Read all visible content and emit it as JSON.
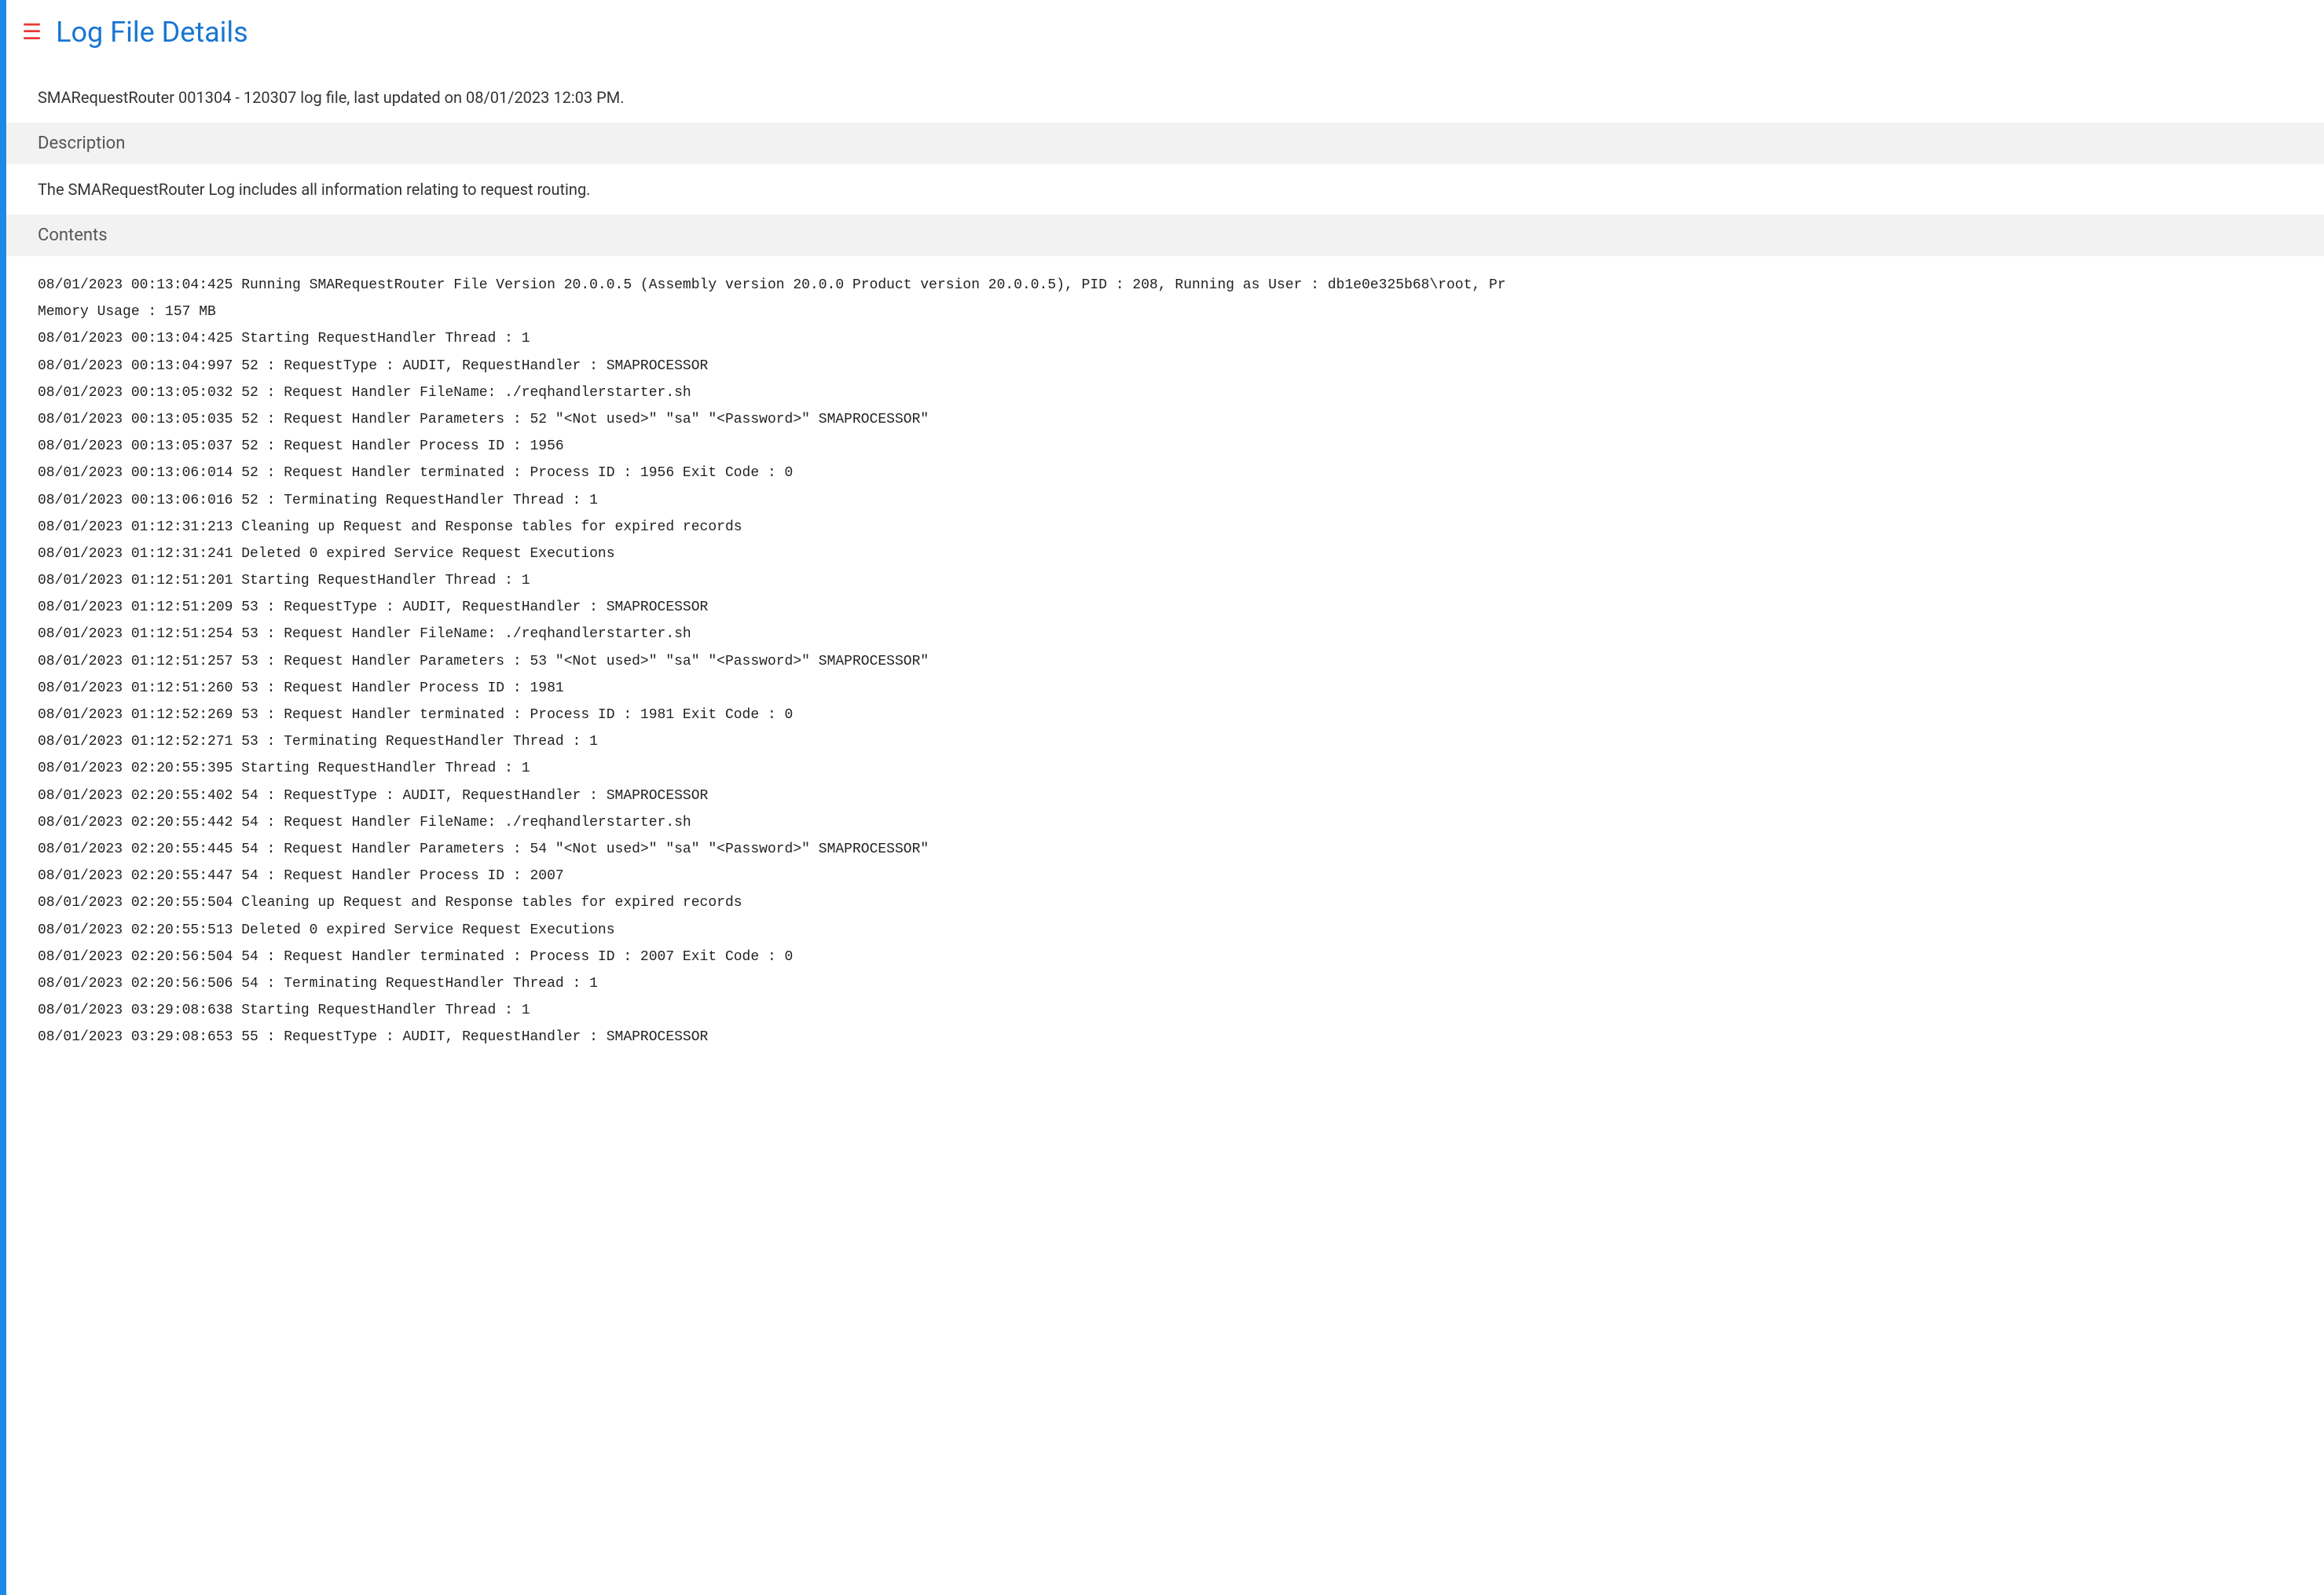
{
  "header": {
    "title": "Log File Details"
  },
  "subtitle": "SMARequestRouter 001304 - 120307 log file, last updated on 08/01/2023 12:03 PM.",
  "sections": {
    "description_label": "Description",
    "description_text": "The SMARequestRouter Log includes all information relating to request routing.",
    "contents_label": "Contents"
  },
  "log_lines": [
    "08/01/2023 00:13:04:425 Running SMARequestRouter File Version 20.0.0.5 (Assembly version 20.0.0 Product version 20.0.0.5), PID : 208, Running as User : db1e0e325b68\\root, Pr",
    "Memory Usage : 157 MB",
    "08/01/2023 00:13:04:425 Starting RequestHandler Thread : 1",
    "08/01/2023 00:13:04:997 52 : RequestType : AUDIT, RequestHandler : SMAPROCESSOR",
    "08/01/2023 00:13:05:032 52 : Request Handler FileName: ./reqhandlerstarter.sh",
    "08/01/2023 00:13:05:035 52 : Request Handler Parameters : 52 \"<Not used>\" \"sa\" \"<Password>\" SMAPROCESSOR\"",
    "08/01/2023 00:13:05:037 52 : Request Handler Process ID : 1956",
    "08/01/2023 00:13:06:014 52 : Request Handler terminated : Process ID : 1956 Exit Code : 0",
    "08/01/2023 00:13:06:016 52 : Terminating RequestHandler Thread : 1",
    "08/01/2023 01:12:31:213 Cleaning up Request and Response tables for expired records",
    "08/01/2023 01:12:31:241 Deleted 0 expired Service Request Executions",
    "08/01/2023 01:12:51:201 Starting RequestHandler Thread : 1",
    "08/01/2023 01:12:51:209 53 : RequestType : AUDIT, RequestHandler : SMAPROCESSOR",
    "08/01/2023 01:12:51:254 53 : Request Handler FileName: ./reqhandlerstarter.sh",
    "08/01/2023 01:12:51:257 53 : Request Handler Parameters : 53 \"<Not used>\" \"sa\" \"<Password>\" SMAPROCESSOR\"",
    "08/01/2023 01:12:51:260 53 : Request Handler Process ID : 1981",
    "08/01/2023 01:12:52:269 53 : Request Handler terminated : Process ID : 1981 Exit Code : 0",
    "08/01/2023 01:12:52:271 53 : Terminating RequestHandler Thread : 1",
    "08/01/2023 02:20:55:395 Starting RequestHandler Thread : 1",
    "08/01/2023 02:20:55:402 54 : RequestType : AUDIT, RequestHandler : SMAPROCESSOR",
    "08/01/2023 02:20:55:442 54 : Request Handler FileName: ./reqhandlerstarter.sh",
    "08/01/2023 02:20:55:445 54 : Request Handler Parameters : 54 \"<Not used>\" \"sa\" \"<Password>\" SMAPROCESSOR\"",
    "08/01/2023 02:20:55:447 54 : Request Handler Process ID : 2007",
    "08/01/2023 02:20:55:504 Cleaning up Request and Response tables for expired records",
    "08/01/2023 02:20:55:513 Deleted 0 expired Service Request Executions",
    "08/01/2023 02:20:56:504 54 : Request Handler terminated : Process ID : 2007 Exit Code : 0",
    "08/01/2023 02:20:56:506 54 : Terminating RequestHandler Thread : 1",
    "08/01/2023 03:29:08:638 Starting RequestHandler Thread : 1",
    "08/01/2023 03:29:08:653 55 : RequestType : AUDIT, RequestHandler : SMAPROCESSOR"
  ]
}
